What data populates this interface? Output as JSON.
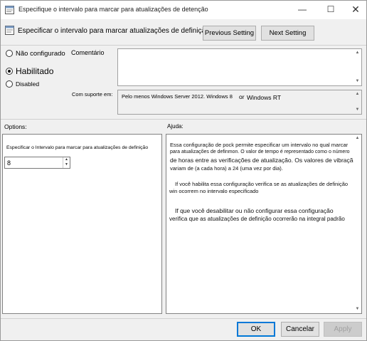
{
  "window": {
    "title": "Especifique o intervalo para marcar para atualizações de detenção",
    "controls": [
      "minimize-icon",
      "maximize-icon",
      "close-icon"
    ]
  },
  "header": {
    "title": "Especificar o intervalo para marcar atualizações de definição",
    "previous_label": "Previous Setting",
    "next_label": "Next Setting"
  },
  "state": {
    "options": [
      {
        "label": "Não configurado",
        "selected": false
      },
      {
        "label": "Habilitado",
        "selected": true
      },
      {
        "label": "Disabled",
        "selected": false
      }
    ]
  },
  "comment": {
    "label": "Comentário",
    "value": ""
  },
  "supported": {
    "label": "Com suporte em:",
    "value_part1": "Pelo menos Windows Server 2012. Windows 8",
    "value_part2": "or",
    "value_part3": "Windows RT"
  },
  "options_section": {
    "label": "Options:",
    "field_label": "Especificar o Intervalo para marcar para atualizações de definição",
    "field_value": "8"
  },
  "help_section": {
    "label": "Ajuda:",
    "p1_line1": "Essa configuração de pock permite especificar um intervalo no qual marcar",
    "p1_line2": "para atualizações de definmon. O valor de tempo é representado como o número",
    "p1_line3": "de horas entre as verificações de atualização. Os valores de vibração",
    "p1_line4": "variam de (a cada hora) a 24 (uma vez por dia).",
    "p2_line1": "If você habilita essa configuração verifica se as atualizações de definição",
    "p2_line2": "win ocorrem no intervalo especificado",
    "p3_line1": "If que você desabilitar ou não configurar essa configuração",
    "p3_line2": "verifica que as atualizações de definição ocorrerão na integral padrão"
  },
  "footer": {
    "ok_label": "OK",
    "cancel_label": "Cancelar",
    "apply_label": "Apply"
  },
  "colors": {
    "dialog_bg": "#f0f0f0",
    "default_button_border": "#0078d7"
  }
}
